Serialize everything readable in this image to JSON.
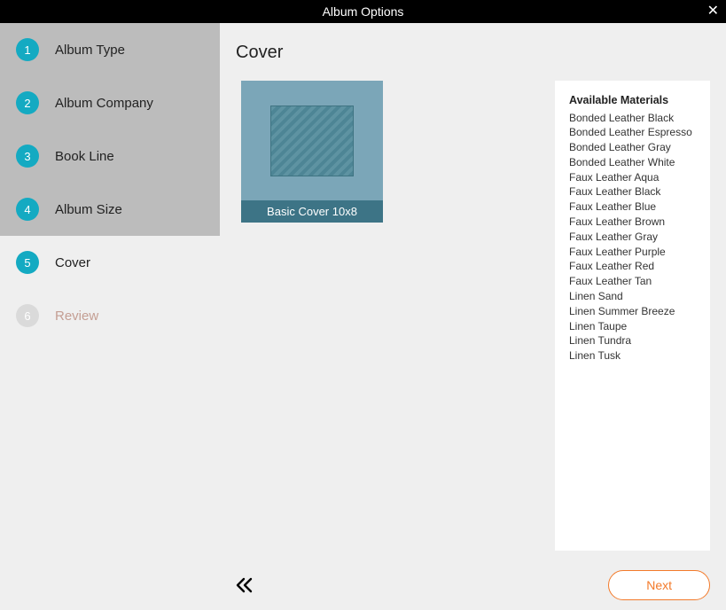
{
  "header": {
    "title": "Album Options"
  },
  "steps": [
    {
      "num": "1",
      "label": "Album Type"
    },
    {
      "num": "2",
      "label": "Album Company"
    },
    {
      "num": "3",
      "label": "Book Line"
    },
    {
      "num": "4",
      "label": "Album Size"
    },
    {
      "num": "5",
      "label": "Cover"
    },
    {
      "num": "6",
      "label": "Review"
    }
  ],
  "page": {
    "title": "Cover"
  },
  "cover": {
    "caption": "Basic Cover 10x8"
  },
  "materials": {
    "header": "Available Materials",
    "items": [
      "Bonded Leather Black",
      "Bonded Leather Espresso",
      "Bonded Leather Gray",
      "Bonded Leather White",
      "Faux Leather Aqua",
      "Faux Leather Black",
      "Faux Leather Blue",
      "Faux Leather Brown",
      "Faux Leather Gray",
      "Faux Leather Purple",
      "Faux Leather Red",
      "Faux Leather Tan",
      "Linen Sand",
      "Linen Summer Breeze",
      "Linen Taupe",
      "Linen Tundra",
      "Linen Tusk"
    ]
  },
  "footer": {
    "next": "Next"
  }
}
